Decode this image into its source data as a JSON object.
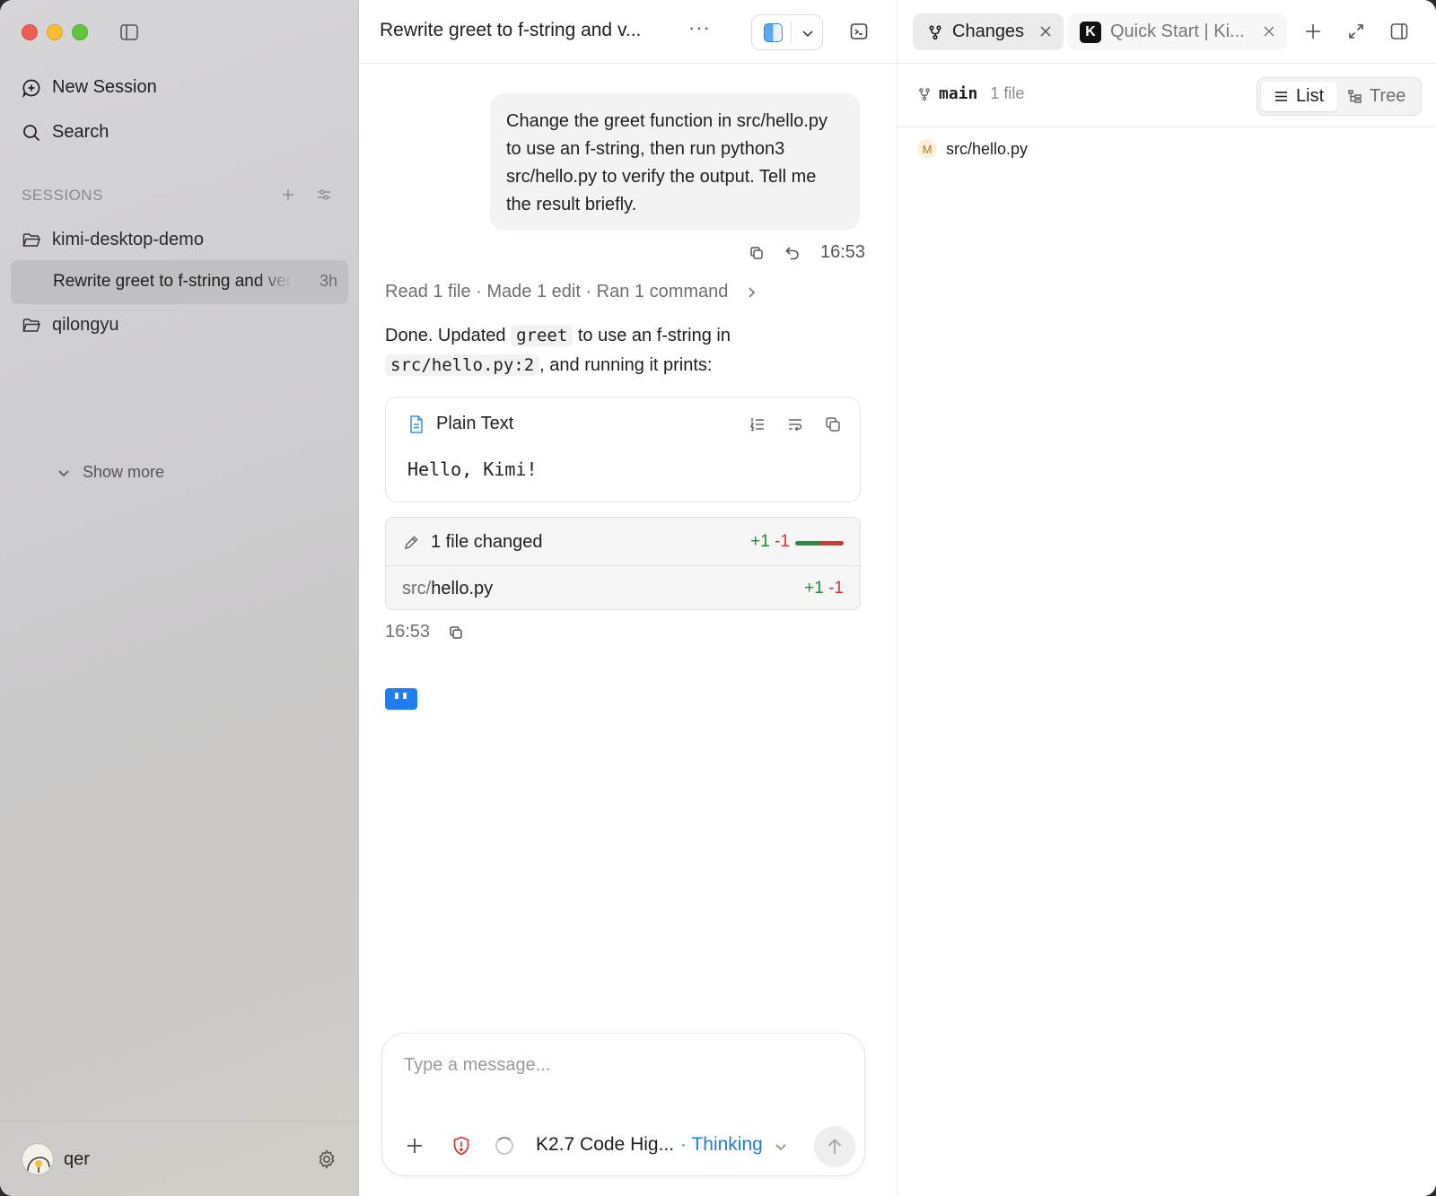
{
  "sidebar": {
    "new_session": "New Session",
    "search": "Search",
    "sessions_header": "SESSIONS",
    "projects": [
      {
        "name": "kimi-desktop-demo"
      },
      {
        "name": "qilongyu"
      }
    ],
    "active_session": {
      "title": "Rewrite greet to f-string and verify",
      "age": "3h"
    },
    "show_more": "Show more",
    "user": {
      "name": "qer"
    }
  },
  "chat": {
    "title": "Rewrite greet to f-string and v...",
    "more": "···",
    "user_message": "Change the greet function in src/hello.py to use an f-string, then run python3 src/hello.py to verify the output. Tell me the result briefly.",
    "user_message_time": "16:53",
    "activity_summary": "Read 1 file · Made 1 edit · Ran 1 command",
    "reply": {
      "part1": "Done. Updated ",
      "code1": "greet",
      "part2": " to use an f-string in ",
      "code2": "src/hello.py:2",
      "part3": ", and running it prints:"
    },
    "code_block": {
      "language": "Plain Text",
      "content": "Hello, Kimi!"
    },
    "changes": {
      "label": "1 file changed",
      "additions": "+1",
      "deletions": "-1",
      "file_dir": "src/",
      "file_name": "hello.py",
      "file_additions": "+1",
      "file_deletions": "-1"
    },
    "reply_time": "16:53"
  },
  "composer": {
    "placeholder": "Type a message...",
    "model": "K2.7 Code Hig...",
    "mode": "· Thinking"
  },
  "right_panel": {
    "tabs": [
      {
        "label": "Changes",
        "active": true,
        "icon": "branch-icon"
      },
      {
        "label": "Quick Start | Ki...",
        "active": false,
        "icon": "kimi-logo",
        "logo_letter": "K"
      }
    ],
    "branch": "main",
    "file_count": "1 file",
    "view_list": "List",
    "view_tree": "Tree",
    "files": [
      {
        "status": "M",
        "path": "src/hello.py"
      }
    ]
  },
  "colors": {
    "accent": "#1d7de8",
    "additions": "#1d8a3a",
    "deletions": "#d0382f",
    "modified_badge": "#b7791f"
  }
}
